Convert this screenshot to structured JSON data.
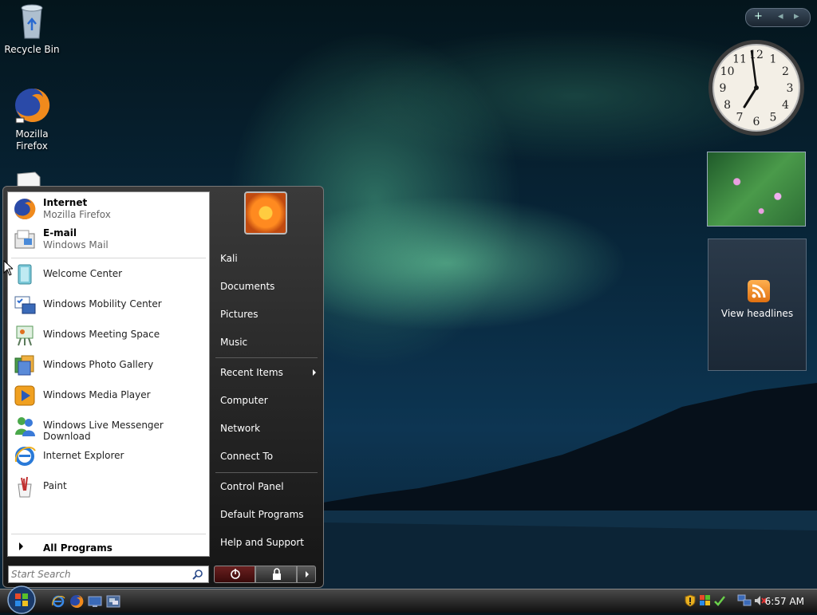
{
  "desktop": {
    "icons": [
      {
        "label": "Recycle Bin",
        "icon": "recycle-bin-icon"
      },
      {
        "label": "Mozilla Firefox",
        "icon": "firefox-icon"
      }
    ]
  },
  "gadgets": {
    "feed_label": "View headlines",
    "clock_numbers": [
      "12",
      "1",
      "2",
      "3",
      "4",
      "5",
      "6",
      "7",
      "8",
      "9",
      "10",
      "11"
    ]
  },
  "start_menu": {
    "pinned": [
      {
        "title": "Internet",
        "subtitle": "Mozilla Firefox",
        "icon": "firefox-icon"
      },
      {
        "title": "E-mail",
        "subtitle": "Windows Mail",
        "icon": "mail-icon"
      }
    ],
    "recent": [
      {
        "label": "Welcome Center",
        "icon": "welcome-center-icon"
      },
      {
        "label": "Windows Mobility Center",
        "icon": "mobility-center-icon"
      },
      {
        "label": "Windows Meeting Space",
        "icon": "meeting-space-icon"
      },
      {
        "label": "Windows Photo Gallery",
        "icon": "photo-gallery-icon"
      },
      {
        "label": "Windows Media Player",
        "icon": "media-player-icon"
      },
      {
        "label": "Windows Live Messenger Download",
        "icon": "messenger-icon"
      },
      {
        "label": "Internet Explorer",
        "icon": "internet-explorer-icon"
      },
      {
        "label": "Paint",
        "icon": "paint-icon"
      }
    ],
    "all_programs": "All Programs",
    "search_placeholder": "Start Search",
    "right": {
      "user": "Kali",
      "documents": "Documents",
      "pictures": "Pictures",
      "music": "Music",
      "recent_items": "Recent Items",
      "computer": "Computer",
      "network": "Network",
      "connect_to": "Connect To",
      "control_panel": "Control Panel",
      "default_programs": "Default Programs",
      "help": "Help and Support"
    }
  },
  "taskbar": {
    "time": "6:57 AM"
  },
  "colors": {
    "accent": "#2f6fd6",
    "menu_dark": "#151515",
    "power_red": "#6a2020"
  }
}
